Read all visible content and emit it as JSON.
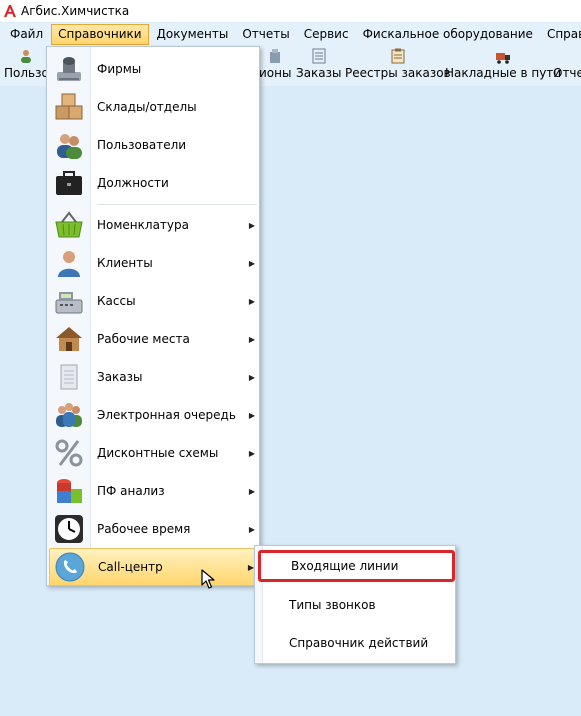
{
  "window": {
    "title": "Агбис.Химчистка",
    "logo_icon": "agbis-logo-icon"
  },
  "menubar": {
    "items": [
      {
        "label": "Файл"
      },
      {
        "label": "Справочники",
        "active": true
      },
      {
        "label": "Документы"
      },
      {
        "label": "Отчеты"
      },
      {
        "label": "Сервис"
      },
      {
        "label": "Фискальное оборудование"
      },
      {
        "label": "Справка"
      }
    ]
  },
  "toolbar": {
    "items": [
      {
        "label": "Пользо",
        "icon": "users-icon"
      },
      {
        "label": "ионы",
        "icon": "regions-icon"
      },
      {
        "label": "Заказы",
        "icon": "orders-icon"
      },
      {
        "label": "Реестры заказов",
        "icon": "order-registry-icon"
      },
      {
        "label": "Накладные в пути",
        "icon": "truck-icon"
      },
      {
        "label": "Отче",
        "icon": "reports-icon"
      }
    ]
  },
  "dropdown": {
    "items": [
      {
        "label": "Фирмы",
        "icon": "firm-stamp-icon",
        "submenu": false
      },
      {
        "label": "Склады/отделы",
        "icon": "warehouse-boxes-icon",
        "submenu": false
      },
      {
        "label": "Пользователи",
        "icon": "users-icon",
        "submenu": false
      },
      {
        "label": "Должности",
        "icon": "briefcase-icon",
        "submenu": false
      },
      {
        "label": "Номенклатура",
        "icon": "basket-icon",
        "submenu": true
      },
      {
        "label": "Клиенты",
        "icon": "client-icon",
        "submenu": true
      },
      {
        "label": "Кассы",
        "icon": "cash-register-icon",
        "submenu": true
      },
      {
        "label": "Рабочие места",
        "icon": "workplace-house-icon",
        "submenu": true
      },
      {
        "label": "Заказы",
        "icon": "order-paper-icon",
        "submenu": true
      },
      {
        "label": "Электронная очередь",
        "icon": "queue-people-icon",
        "submenu": true
      },
      {
        "label": "Дисконтные схемы",
        "icon": "percent-icon",
        "submenu": true
      },
      {
        "label": "ПФ анализ",
        "icon": "analysis-cubes-icon",
        "submenu": true
      },
      {
        "label": "Рабочее время",
        "icon": "clock-icon",
        "submenu": true
      },
      {
        "label": "Call-центр",
        "icon": "phone-icon",
        "submenu": true,
        "highlighted": true
      }
    ]
  },
  "submenu": {
    "items": [
      {
        "label": "Входящие линии",
        "selected": true
      },
      {
        "label": "Типы звонков"
      },
      {
        "label": "Справочник действий"
      }
    ]
  },
  "colors": {
    "background": "#d9ebf8",
    "menu_highlight": "#ffd66e",
    "selection_outline": "#d9262b"
  }
}
